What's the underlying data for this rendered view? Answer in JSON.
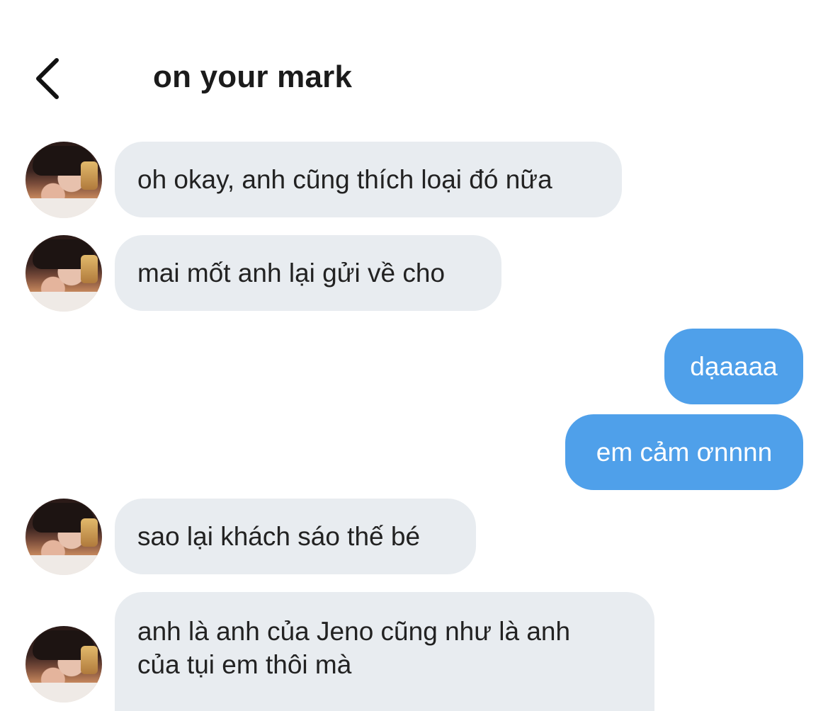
{
  "header": {
    "title": "on your mark",
    "back_icon": "chevron-left-icon"
  },
  "colors": {
    "incoming_bubble": "#e8ecf0",
    "outgoing_bubble": "#4fa0ea",
    "background": "#ffffff"
  },
  "messages": [
    {
      "direction": "incoming",
      "lines": [
        "oh okay, anh cũng thích loại đó nữa"
      ],
      "avatar": "avatar"
    },
    {
      "direction": "incoming",
      "lines": [
        "mai mốt anh lại gửi về cho"
      ],
      "avatar": "avatar"
    },
    {
      "direction": "outgoing",
      "lines": [
        "dạaaaa"
      ]
    },
    {
      "direction": "outgoing",
      "lines": [
        "em cảm ơnnnn"
      ]
    },
    {
      "direction": "incoming",
      "lines": [
        "sao lại khách sáo thế bé"
      ],
      "avatar": "avatar"
    },
    {
      "direction": "incoming",
      "lines": [
        "anh là anh của Jeno cũng như là anh",
        "của tụi em thôi mà"
      ],
      "avatar": "avatar"
    }
  ]
}
